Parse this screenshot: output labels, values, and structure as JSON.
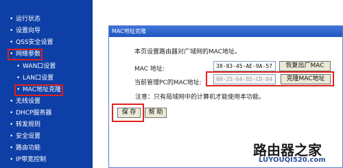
{
  "sidebar": {
    "items": [
      {
        "label": "运行状态"
      },
      {
        "label": "设置向导"
      },
      {
        "label": "QSS安全设置"
      },
      {
        "label": "网络参数"
      },
      {
        "label": "WAN口设置"
      },
      {
        "label": "LAN口设置"
      },
      {
        "label": "MAC地址克隆"
      },
      {
        "label": "无线设置"
      },
      {
        "label": "DHCP服务器"
      },
      {
        "label": "转发规则"
      },
      {
        "label": "安全设置"
      },
      {
        "label": "路由功能"
      },
      {
        "label": "IP带宽控制"
      }
    ]
  },
  "panel": {
    "title": "MAC地址克隆",
    "description": "本页设置路由器对广域网的MAC地址。",
    "mac_label": "MAC 地址:",
    "mac_value": "38-83-45-AE-9A-57",
    "restore_button": "恢复出厂MAC",
    "pc_mac_label": "当前管理PC的MAC地址:",
    "pc_mac_value": "00-25-64-85-CD-84",
    "clone_button": "克隆MAC地址",
    "note": "注意：只有局域网中的计算机才能使用本功能。",
    "save_button": "保 存",
    "help_button": "帮 助"
  },
  "watermark": {
    "site_name": "路由器之家",
    "site_url": "LUYOUQI520.com"
  },
  "colors": {
    "sidebar_bg": "#0d3fa6",
    "highlight": "#e0201a",
    "panel_title_bg": "#2f66cf"
  }
}
